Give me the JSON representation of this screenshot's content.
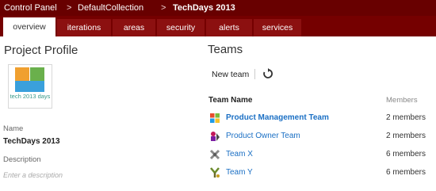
{
  "breadcrumb": {
    "items": [
      "Control Panel",
      "DefaultCollection",
      "TechDays 2013"
    ],
    "separator": ">"
  },
  "tabs": [
    {
      "label": "overview",
      "active": true
    },
    {
      "label": "iterations",
      "active": false
    },
    {
      "label": "areas",
      "active": false
    },
    {
      "label": "security",
      "active": false
    },
    {
      "label": "alerts",
      "active": false
    },
    {
      "label": "services",
      "active": false
    }
  ],
  "profile": {
    "title": "Project Profile",
    "logo_text": "tech 2013 days",
    "name_label": "Name",
    "name_value": "TechDays 2013",
    "description_label": "Description",
    "description_placeholder": "Enter a description"
  },
  "teams": {
    "title": "Teams",
    "new_team_label": "New team",
    "columns": {
      "name": "Team Name",
      "members": "Members"
    },
    "rows": [
      {
        "name": "Product Management Team",
        "members": "2 members",
        "icon": "windows-team-icon",
        "bold": true
      },
      {
        "name": "Product Owner Team",
        "members": "2 members",
        "icon": "owner-team-icon",
        "bold": false
      },
      {
        "name": "Team X",
        "members": "6 members",
        "icon": "team-x-icon",
        "bold": false
      },
      {
        "name": "Team Y",
        "members": "6 members",
        "icon": "team-y-icon",
        "bold": false
      }
    ]
  },
  "colors": {
    "header_bg": "#680000",
    "tabbar_bg": "#750000",
    "link": "#1a6fc4"
  }
}
